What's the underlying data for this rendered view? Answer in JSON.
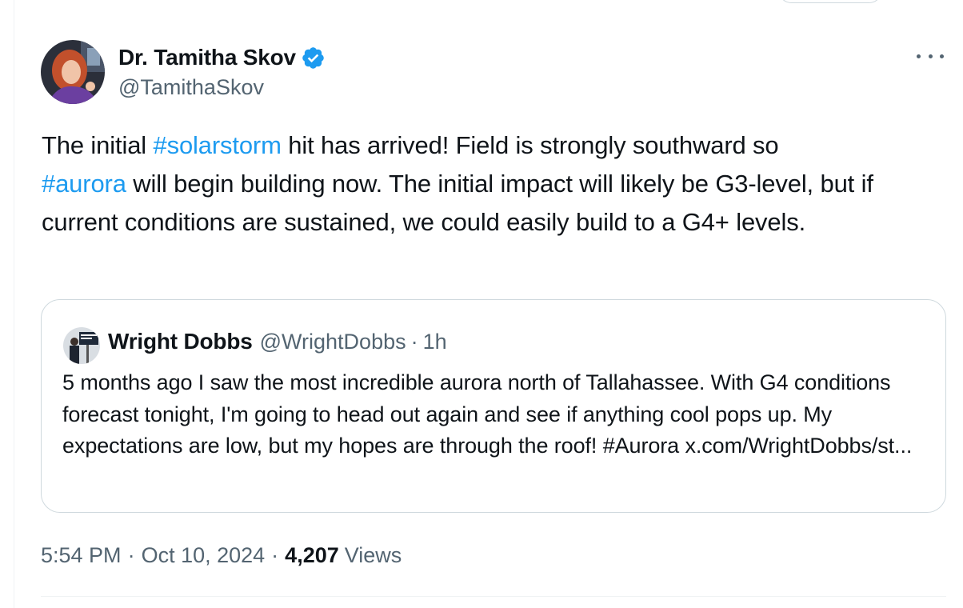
{
  "author": {
    "name": "Dr. Tamitha Skov",
    "handle": "@TamithaSkov",
    "verified": true
  },
  "tweet": {
    "segments": [
      {
        "text": "The initial ",
        "type": "text"
      },
      {
        "text": "#solarstorm",
        "type": "hashtag"
      },
      {
        "text": " hit has arrived! Field is strongly southward so ",
        "type": "text"
      },
      {
        "text": "#aurora",
        "type": "hashtag"
      },
      {
        "text": " will begin building now. The initial impact will likely be G3-level, but if current conditions are sustained, we could easily build to a G4+ levels.",
        "type": "text"
      }
    ]
  },
  "quoted_tweet": {
    "name": "Wright Dobbs",
    "handle": "@WrightDobbs",
    "separator": "·",
    "time": "1h",
    "text": "5 months ago I saw the most incredible aurora north of Tallahassee. With G4 conditions forecast tonight, I'm going to head out again and see if anything cool pops up. My expectations are low, but my hopes are through the roof! #Aurora x.com/WrightDobbs/st..."
  },
  "meta": {
    "time": "5:54 PM",
    "separator": "·",
    "date": "Oct 10, 2024",
    "views_count": "4,207",
    "views_label": "Views"
  },
  "colors": {
    "link": "#1d9bf0",
    "secondary_text": "#536471",
    "primary_text": "#0f1419",
    "border": "#cfd9de",
    "verified_badge": "#1d9bf0"
  },
  "icons": {
    "verified": "verified-badge-icon",
    "more": "more-horizontal-icon"
  }
}
